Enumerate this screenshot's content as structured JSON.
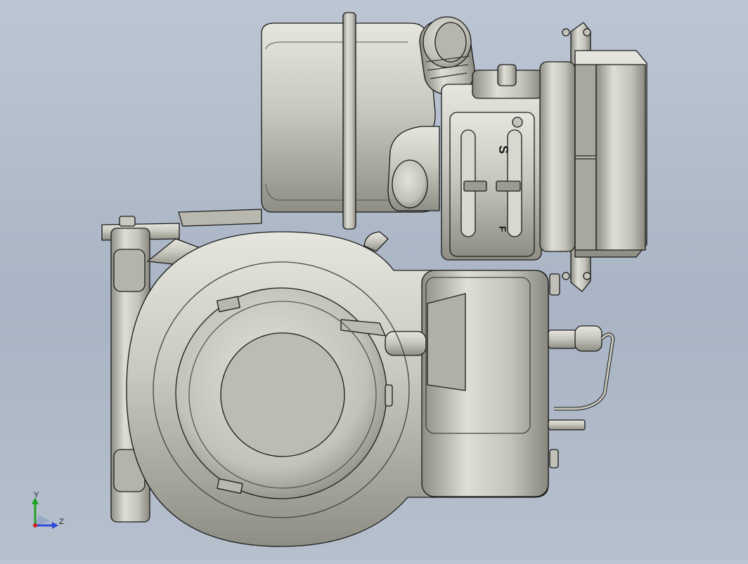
{
  "engine_labels": {
    "slider_top": "S",
    "slider_bottom": "F"
  },
  "triad": {
    "y_axis_label": "Y",
    "z_axis_label": "Z",
    "y_color": "#22a022",
    "z_color": "#2a4ad8",
    "x_color": "#d02020"
  },
  "colors": {
    "background_top": "#bcc6d3",
    "background_bottom": "#a9b4c4",
    "metal_fill": "#c8c8bf",
    "metal_shadow": "#8f8f86",
    "outline": "#1a1a1a"
  }
}
